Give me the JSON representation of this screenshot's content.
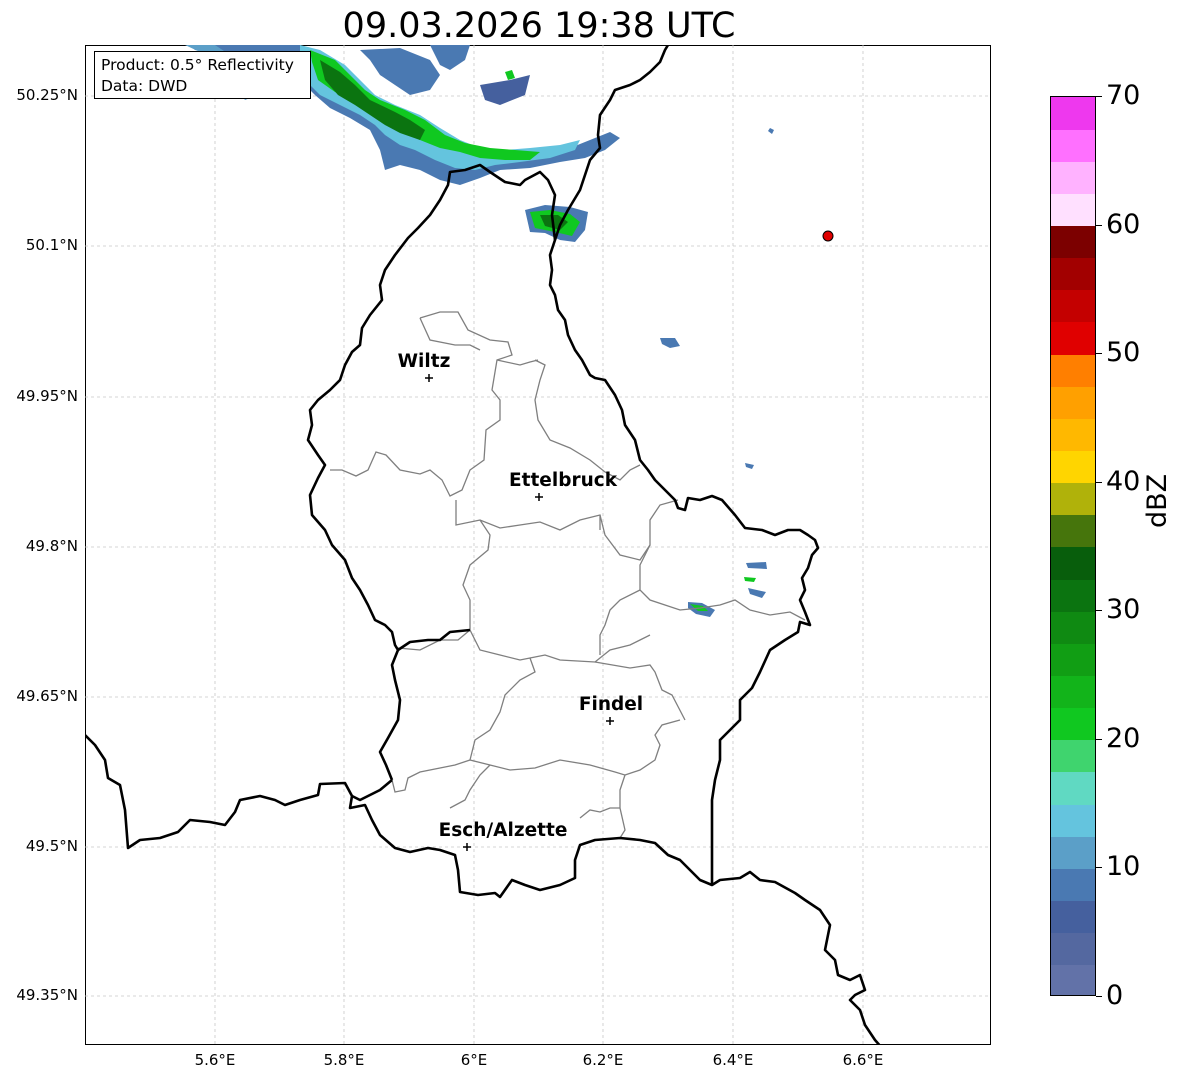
{
  "title": "09.03.2026 19:38 UTC",
  "info_box": {
    "product": "Product: 0.5° Reflectivity",
    "source": "Data: DWD"
  },
  "lat_labels": [
    "50.25°N",
    "50.1°N",
    "49.95°N",
    "49.8°N",
    "49.65°N",
    "49.5°N",
    "49.35°N"
  ],
  "lon_labels": [
    "5.6°E",
    "5.8°E",
    "6°E",
    "6.2°E",
    "6.4°E",
    "6.6°E"
  ],
  "cities": [
    {
      "name": "Wiltz"
    },
    {
      "name": "Ettelbruck"
    },
    {
      "name": "Findel"
    },
    {
      "name": "Esch/Alzette"
    }
  ],
  "colorbar": {
    "label": "dBZ",
    "min": 0,
    "max": 70,
    "step": 2.5,
    "tick_labels": [
      "0",
      "10",
      "20",
      "30",
      "40",
      "50",
      "60",
      "70"
    ],
    "colors": [
      "#6272a8",
      "#5468a0",
      "#45609e",
      "#4a79b2",
      "#5b9fc8",
      "#64c4de",
      "#60d9c2",
      "#3fd46e",
      "#10c820",
      "#12b41a",
      "#119e14",
      "#0f8a12",
      "#0b7410",
      "#085e0c",
      "#46750c",
      "#b0b20a",
      "#ffd500",
      "#ffb800",
      "#ffa000",
      "#ff7f00",
      "#e00000",
      "#c40000",
      "#a20000",
      "#7c0000",
      "#ffe0ff",
      "#ffb2ff",
      "#ff70ff",
      "#ee38ee"
    ]
  },
  "colors": {
    "border_national": "#000000",
    "border_cantonal": "#7f7f7f",
    "radar_site_marker": "#e00000"
  }
}
